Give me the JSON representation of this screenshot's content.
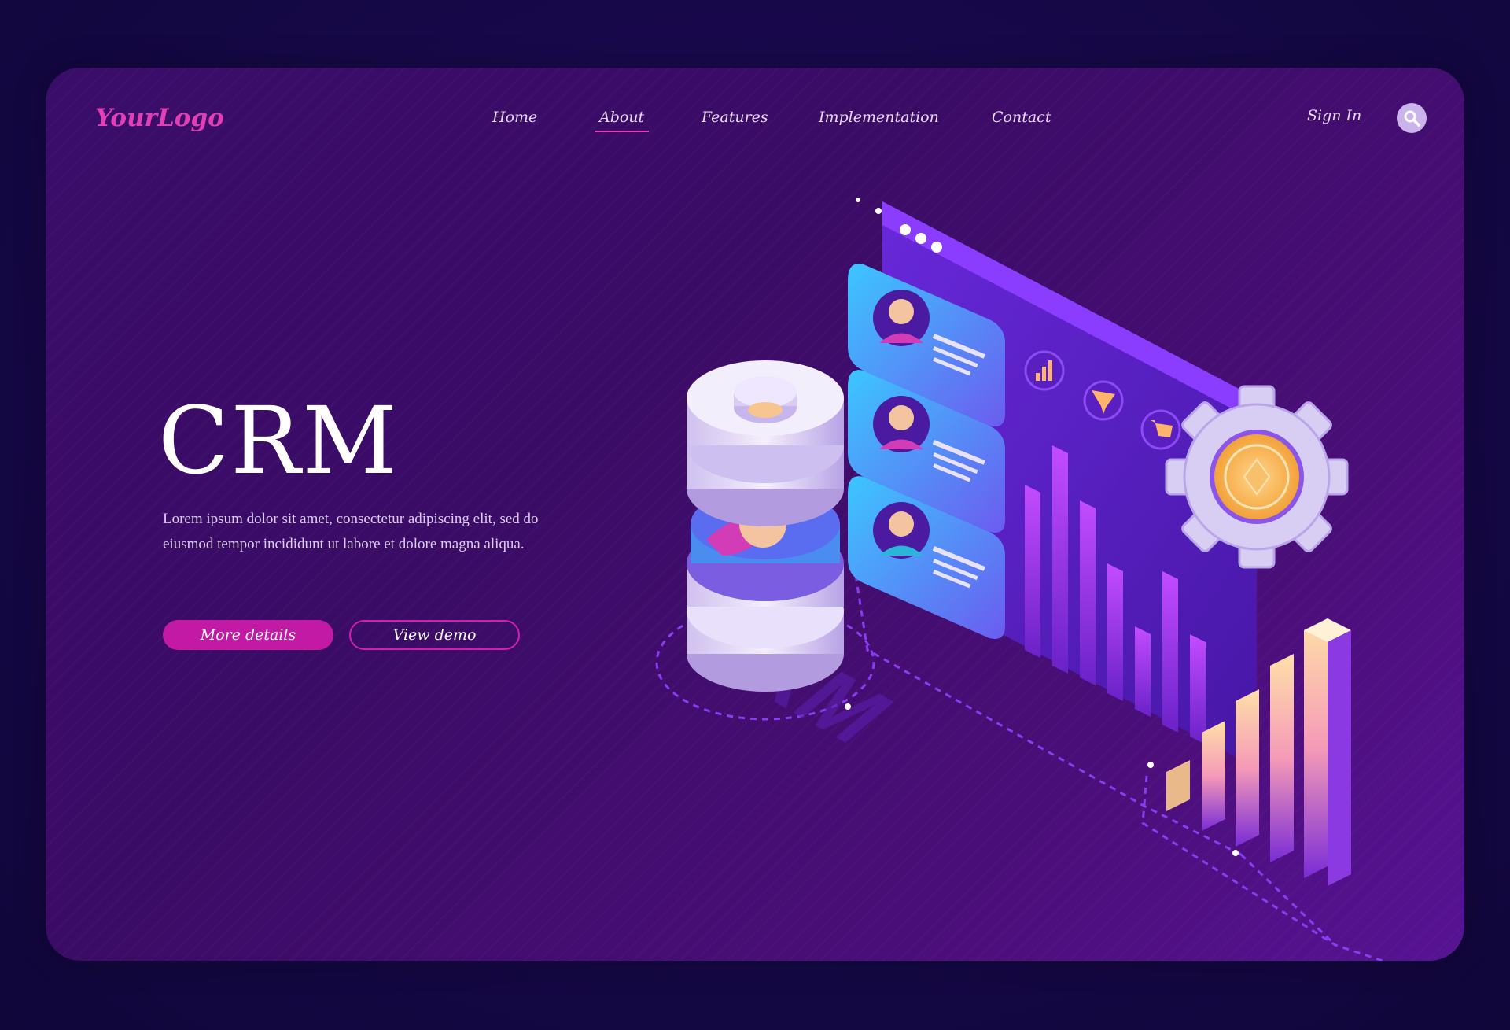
{
  "header": {
    "logo": "YourLogo",
    "nav": [
      {
        "label": "Home"
      },
      {
        "label": "About",
        "active": true
      },
      {
        "label": "Features"
      },
      {
        "label": "Implementation"
      },
      {
        "label": "Contact"
      }
    ],
    "sign_in": "Sign In"
  },
  "hero": {
    "title": "CRM",
    "description": "Lorem ipsum dolor sit amet, consectetur adipiscing elit, sed do eiusmod tempor incididunt ut labore et dolore magna aliqua.",
    "primary_button": "More details",
    "secondary_button": "View demo"
  },
  "illustration": {
    "watermark": "CRM",
    "icons": [
      "database-icon",
      "user-card-icon",
      "bar-chart-icon",
      "funnel-icon",
      "cart-icon",
      "gear-icon",
      "coin-icon"
    ]
  },
  "colors": {
    "background": "#150845",
    "card": "#3b0c66",
    "accent": "#e23fb6",
    "button": "#c21aa4"
  }
}
